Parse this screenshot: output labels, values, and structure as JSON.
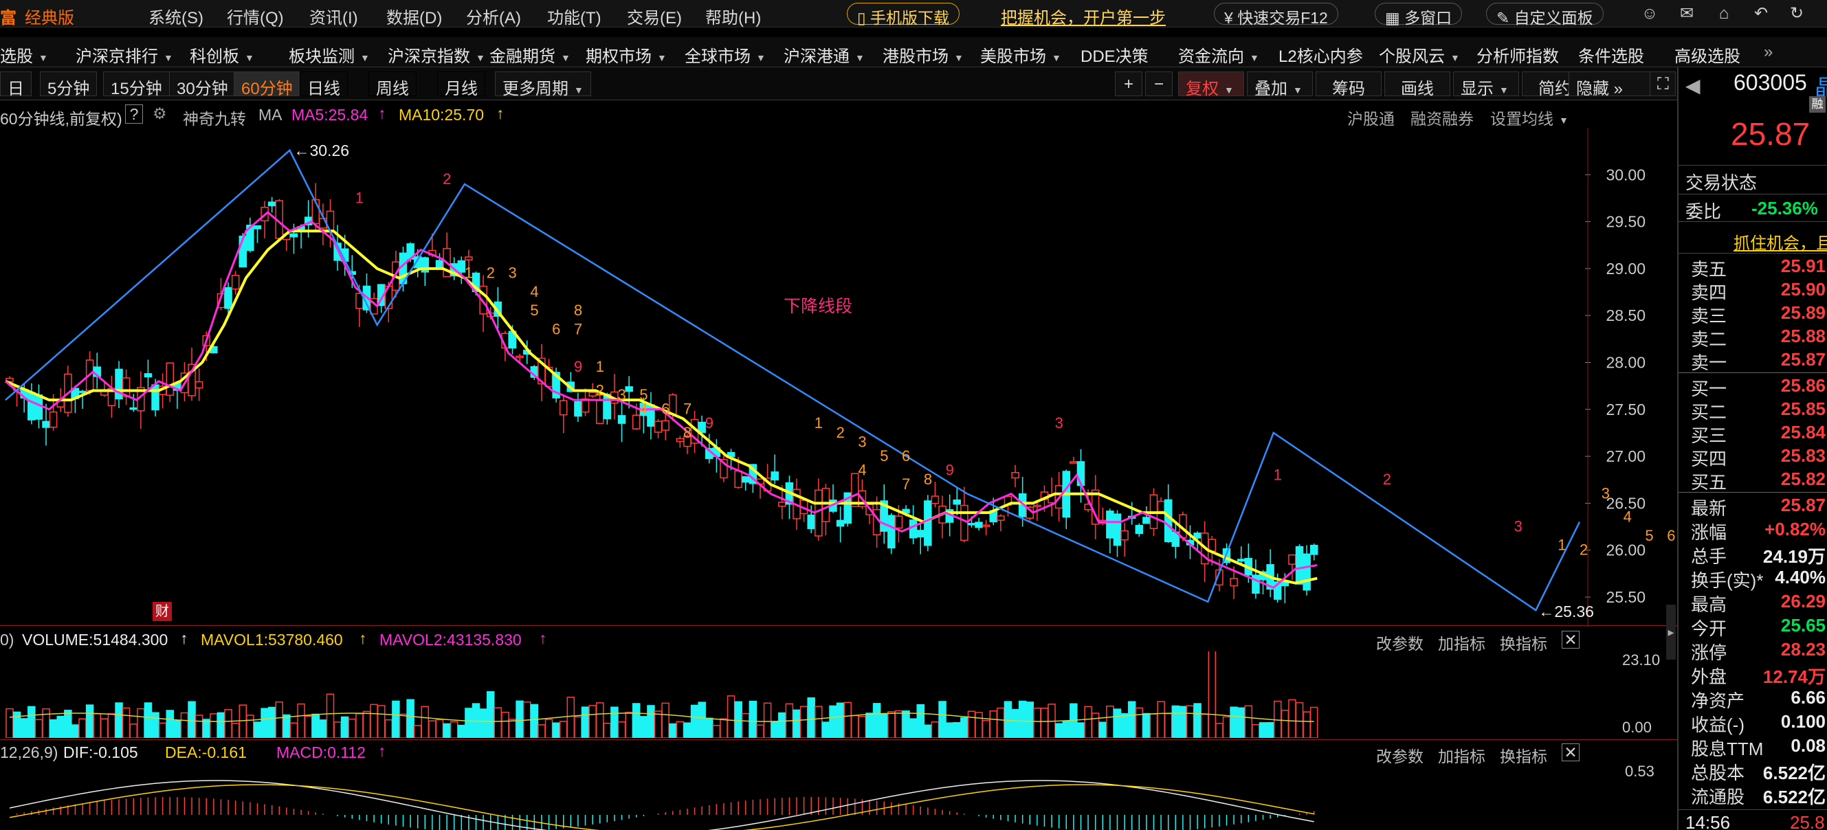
{
  "app": {
    "brand": "经典版",
    "brand_glyph": "富"
  },
  "menu": {
    "items": [
      "系统(S)",
      "行情(Q)",
      "资讯(I)",
      "数据(D)",
      "分析(A)",
      "功能(T)",
      "交易(E)",
      "帮助(H)"
    ],
    "mobile_download": "手机版下载",
    "promo": "把握机会，开户第一步",
    "quick_trade": "快速交易F12",
    "multi_window": "多窗口",
    "custom_panel": "自定义面板",
    "icons": [
      "user-icon",
      "mail-icon",
      "home-icon",
      "back-icon",
      "refresh-icon"
    ]
  },
  "nav": {
    "items": [
      "选股",
      "沪深京排行",
      "科创板",
      "板块监测",
      "沪深京指数",
      "金融期货",
      "期权市场",
      "全球市场",
      "沪深港通",
      "港股市场",
      "美股市场",
      "DDE决策",
      "资金流向",
      "L2核心内参",
      "个股风云",
      "分析师指数",
      "条件选股",
      "高级选股"
    ],
    "more": "»"
  },
  "periods": {
    "items": [
      "日",
      "5分钟",
      "15分钟",
      "30分钟",
      "60分钟",
      "日线",
      "周线",
      "月线",
      "更多周期"
    ],
    "active": "60分钟"
  },
  "tools": {
    "items": [
      "复权",
      "叠加",
      "筹码",
      "画线",
      "显示",
      "简约",
      "隐藏"
    ],
    "plus": "+",
    "minus": "−"
  },
  "chart_info": {
    "title": "60分钟线,前复权)",
    "help": "?",
    "indicator": "神奇九转",
    "ma_label": "MA",
    "ma5": "MA5:25.84",
    "ma10": "MA10:25.70",
    "links": [
      "沪股通",
      "融资融券",
      "设置均线"
    ],
    "annotation_label": "下降线段",
    "high_marker": "30.26",
    "low_marker": "25.36",
    "cai_badge": "财"
  },
  "volume_info": {
    "prefix": "0)",
    "volume": "VOLUME:51484.300",
    "mavol1": "MAVOL1:53780.460",
    "mavol2": "MAVOL2:43135.830",
    "actions": [
      "改参数",
      "加指标",
      "换指标"
    ],
    "axis_top": "23.10",
    "axis_bottom": "0.00"
  },
  "macd_info": {
    "prefix": "12,26,9)",
    "dif": "DIF:-0.105",
    "dea": "DEA:-0.161",
    "macd": "MACD:0.112",
    "actions": [
      "改参数",
      "加指标",
      "换指标"
    ],
    "axis_top": "0.53"
  },
  "chart_data": {
    "type": "candlestick",
    "title": "",
    "y_ticks": [
      "30.00",
      "29.50",
      "29.00",
      "28.50",
      "28.00",
      "27.50",
      "27.00",
      "26.50",
      "26.00",
      "25.50"
    ],
    "ylim": [
      25.2,
      30.5
    ],
    "highest": 30.26,
    "lowest": 25.36,
    "ma5_series": [
      27.8,
      27.6,
      27.5,
      27.7,
      27.9,
      27.7,
      27.6,
      27.8,
      27.7,
      28.1,
      28.8,
      29.4,
      29.6,
      29.4,
      29.5,
      29.3,
      28.8,
      28.6,
      29.0,
      29.2,
      29.1,
      28.9,
      28.6,
      28.1,
      27.9,
      27.7,
      27.6,
      27.6,
      27.6,
      27.5,
      27.5,
      27.3,
      27.1,
      26.9,
      26.8,
      26.6,
      26.5,
      26.4,
      26.5,
      26.6,
      26.3,
      26.2,
      26.3,
      26.4,
      26.3,
      26.5,
      26.6,
      26.4,
      26.5,
      26.8,
      26.3,
      26.3,
      26.4,
      26.3,
      26.1,
      25.9,
      25.8,
      25.7,
      25.6,
      25.8,
      25.84
    ],
    "ma10_series": [
      27.8,
      27.7,
      27.6,
      27.6,
      27.7,
      27.7,
      27.7,
      27.7,
      27.8,
      28.0,
      28.4,
      28.9,
      29.2,
      29.4,
      29.4,
      29.4,
      29.2,
      29.0,
      28.9,
      29.0,
      29.0,
      28.9,
      28.7,
      28.4,
      28.1,
      27.9,
      27.7,
      27.7,
      27.6,
      27.6,
      27.5,
      27.4,
      27.2,
      27.0,
      26.9,
      26.7,
      26.6,
      26.5,
      26.5,
      26.5,
      26.5,
      26.4,
      26.3,
      26.4,
      26.4,
      26.4,
      26.5,
      26.5,
      26.6,
      26.6,
      26.6,
      26.5,
      26.4,
      26.4,
      26.2,
      26.0,
      25.9,
      25.8,
      25.7,
      25.65,
      25.7
    ],
    "zigzag": [
      [
        0,
        27.6
      ],
      [
        13,
        30.26
      ],
      [
        17,
        28.4
      ],
      [
        21,
        29.9
      ],
      [
        44,
        26.6
      ],
      [
        55,
        25.45
      ],
      [
        58,
        27.25
      ],
      [
        70,
        25.36
      ],
      [
        72,
        26.3
      ]
    ],
    "td_labels": [
      {
        "i": 16,
        "price": 29.7,
        "text": "1",
        "color": "red"
      },
      {
        "i": 20,
        "price": 29.9,
        "text": "2",
        "color": "red"
      },
      {
        "i": 21,
        "price": 28.9,
        "text": "1",
        "color": "orange"
      },
      {
        "i": 22,
        "price": 28.9,
        "text": "2",
        "color": "orange"
      },
      {
        "i": 23,
        "price": 28.9,
        "text": "3",
        "color": "orange"
      },
      {
        "i": 24,
        "price": 28.7,
        "text": "4",
        "color": "orange"
      },
      {
        "i": 24,
        "price": 28.5,
        "text": "5",
        "color": "orange"
      },
      {
        "i": 25,
        "price": 28.3,
        "text": "6",
        "color": "orange"
      },
      {
        "i": 26,
        "price": 28.3,
        "text": "7",
        "color": "orange"
      },
      {
        "i": 26,
        "price": 28.5,
        "text": "8",
        "color": "orange"
      },
      {
        "i": 26,
        "price": 27.9,
        "text": "9",
        "color": "red"
      },
      {
        "i": 27,
        "price": 27.9,
        "text": "1",
        "color": "orange"
      },
      {
        "i": 27,
        "price": 27.65,
        "text": "2",
        "color": "orange"
      },
      {
        "i": 28,
        "price": 27.6,
        "text": "3",
        "color": "orange"
      },
      {
        "i": 29,
        "price": 27.45,
        "text": "4",
        "color": "orange"
      },
      {
        "i": 29,
        "price": 27.6,
        "text": "5",
        "color": "orange"
      },
      {
        "i": 30,
        "price": 27.45,
        "text": "6",
        "color": "orange"
      },
      {
        "i": 31,
        "price": 27.45,
        "text": "7",
        "color": "orange"
      },
      {
        "i": 31,
        "price": 27.2,
        "text": "8",
        "color": "orange"
      },
      {
        "i": 32,
        "price": 27.3,
        "text": "9",
        "color": "red"
      },
      {
        "i": 37,
        "price": 27.3,
        "text": "1",
        "color": "orange"
      },
      {
        "i": 38,
        "price": 27.2,
        "text": "2",
        "color": "orange"
      },
      {
        "i": 39,
        "price": 27.1,
        "text": "3",
        "color": "orange"
      },
      {
        "i": 39,
        "price": 26.8,
        "text": "4",
        "color": "orange"
      },
      {
        "i": 40,
        "price": 26.95,
        "text": "5",
        "color": "orange"
      },
      {
        "i": 41,
        "price": 26.95,
        "text": "6",
        "color": "orange"
      },
      {
        "i": 41,
        "price": 26.65,
        "text": "7",
        "color": "orange"
      },
      {
        "i": 42,
        "price": 26.7,
        "text": "8",
        "color": "orange"
      },
      {
        "i": 43,
        "price": 26.8,
        "text": "9",
        "color": "red"
      },
      {
        "i": 48,
        "price": 27.3,
        "text": "3",
        "color": "red"
      },
      {
        "i": 58,
        "price": 26.75,
        "text": "1",
        "color": "red"
      },
      {
        "i": 63,
        "price": 26.7,
        "text": "2",
        "color": "red"
      },
      {
        "i": 69,
        "price": 26.2,
        "text": "3",
        "color": "red"
      },
      {
        "i": 71,
        "price": 26.0,
        "text": "1",
        "color": "orange"
      },
      {
        "i": 72,
        "price": 25.95,
        "text": "2",
        "color": "orange"
      },
      {
        "i": 73,
        "price": 26.55,
        "text": "3",
        "color": "orange"
      },
      {
        "i": 74,
        "price": 26.3,
        "text": "4",
        "color": "orange"
      },
      {
        "i": 75,
        "price": 26.1,
        "text": "5",
        "color": "orange"
      },
      {
        "i": 76,
        "price": 26.1,
        "text": "6",
        "color": "orange"
      }
    ]
  },
  "quote": {
    "code": "603005",
    "code_suffix": "晶",
    "margin_badge": "融",
    "price": "25.87",
    "status_label": "交易状态",
    "weibi_label": "委比",
    "weibi_value": "-25.36%",
    "promo": "抓住机会，且",
    "asks": [
      {
        "label": "卖五",
        "price": "25.91"
      },
      {
        "label": "卖四",
        "price": "25.90"
      },
      {
        "label": "卖三",
        "price": "25.89"
      },
      {
        "label": "卖二",
        "price": "25.88"
      },
      {
        "label": "卖一",
        "price": "25.87"
      }
    ],
    "bids": [
      {
        "label": "买一",
        "price": "25.86"
      },
      {
        "label": "买二",
        "price": "25.85"
      },
      {
        "label": "买三",
        "price": "25.84"
      },
      {
        "label": "买四",
        "price": "25.83"
      },
      {
        "label": "买五",
        "price": "25.82"
      }
    ],
    "stats": [
      {
        "label": "最新",
        "value": "25.87",
        "color": "red"
      },
      {
        "label": "涨幅",
        "value": "+0.82%",
        "color": "red"
      },
      {
        "label": "总手",
        "value": "24.19万",
        "color": "white"
      },
      {
        "label": "换手(实)*",
        "value": "4.40%",
        "color": "white"
      },
      {
        "label": "最高",
        "value": "26.29",
        "color": "red"
      },
      {
        "label": "今开",
        "value": "25.65",
        "color": "green"
      },
      {
        "label": "涨停",
        "value": "28.23",
        "color": "red"
      },
      {
        "label": "外盘",
        "value": "12.74万",
        "color": "red"
      },
      {
        "label": "净资产",
        "value": "6.66",
        "color": "white"
      },
      {
        "label": "收益(-)",
        "value": "0.100",
        "color": "white"
      },
      {
        "label": "股息TTM",
        "value": "0.08",
        "color": "white"
      },
      {
        "label": "总股本",
        "value": "6.522亿",
        "color": "white"
      },
      {
        "label": "流通股",
        "value": "6.522亿",
        "color": "white"
      }
    ],
    "time": "14:56",
    "time_price": "25.8"
  }
}
